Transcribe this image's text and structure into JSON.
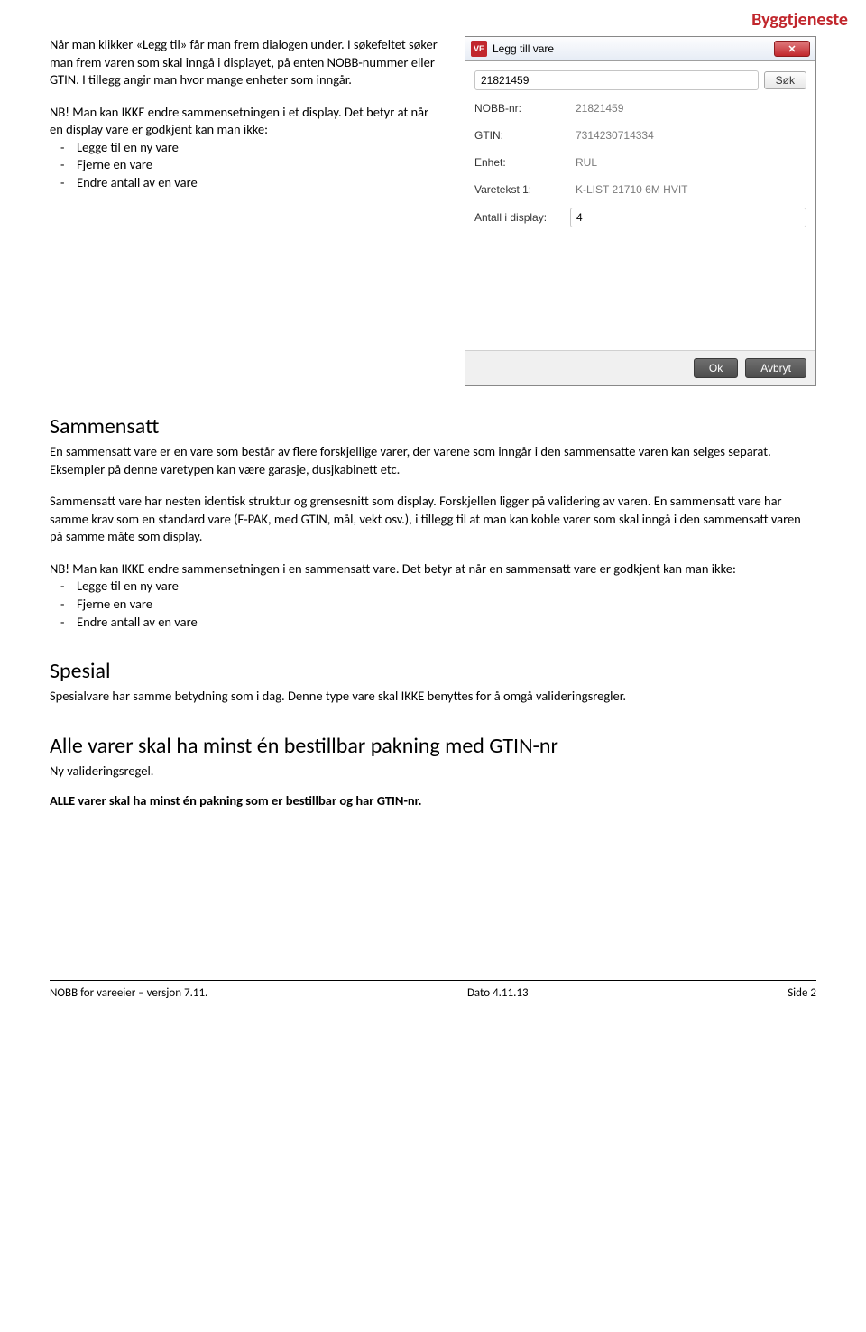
{
  "logo": {
    "part1": "Bygg",
    "part2": "tjeneste"
  },
  "left": {
    "p1": "Når man klikker «Legg til» får man frem dialogen under. I søkefeltet søker man frem varen som skal inngå i displayet, på enten NOBB-nummer eller GTIN. I tillegg angir man hvor mange enheter som inngår.",
    "nb1": "NB! Man kan IKKE endre sammensetningen i et display. Det betyr at når en display vare er godkjent kan man ikke:",
    "nb1_items": [
      "Legge til en ny vare",
      "Fjerne en vare",
      "Endre antall av en vare"
    ]
  },
  "dialog": {
    "title": "Legg till vare",
    "search_value": "21821459",
    "search_btn": "Søk",
    "rows": [
      {
        "label": "NOBB-nr:",
        "value": "21821459"
      },
      {
        "label": "GTIN:",
        "value": "7314230714334"
      },
      {
        "label": "Enhet:",
        "value": "RUL"
      },
      {
        "label": "Varetekst 1:",
        "value": "K-LIST 21710 6M HVIT"
      }
    ],
    "antall_label": "Antall i display:",
    "antall_value": "4",
    "ok": "Ok",
    "cancel": "Avbryt"
  },
  "sammensatt": {
    "heading": "Sammensatt",
    "p1": "En sammensatt vare er en vare som består av flere forskjellige varer, der varene som inngår i den sammensatte varen kan selges separat. Eksempler på denne varetypen kan være garasje, dusjkabinett etc.",
    "p2": "Sammensatt vare har nesten identisk struktur og grensesnitt som display. Forskjellen ligger på validering av varen. En sammensatt vare har samme krav som en standard vare (F-PAK, med GTIN, mål, vekt osv.), i tillegg til at man kan koble varer som skal inngå i den sammensatt varen på samme måte som display.",
    "nb2": "NB! Man kan IKKE endre sammensetningen i en sammensatt vare. Det betyr at når en sammensatt vare er godkjent kan man ikke:",
    "nb2_items": [
      "Legge til en ny vare",
      "Fjerne en vare",
      "Endre antall av en vare"
    ]
  },
  "spesial": {
    "heading": "Spesial",
    "p1": "Spesialvare har samme betydning som i dag. Denne type vare skal IKKE benyttes for å omgå valideringsregler."
  },
  "gtin": {
    "heading": "Alle varer skal ha minst én bestillbar pakning med GTIN-nr",
    "sub": "Ny valideringsregel.",
    "bold": "ALLE varer skal ha minst én pakning som er bestillbar og har GTIN-nr."
  },
  "footer": {
    "left": "NOBB for vareeier – versjon 7.11.",
    "center": "Dato 4.11.13",
    "right": "Side 2"
  }
}
